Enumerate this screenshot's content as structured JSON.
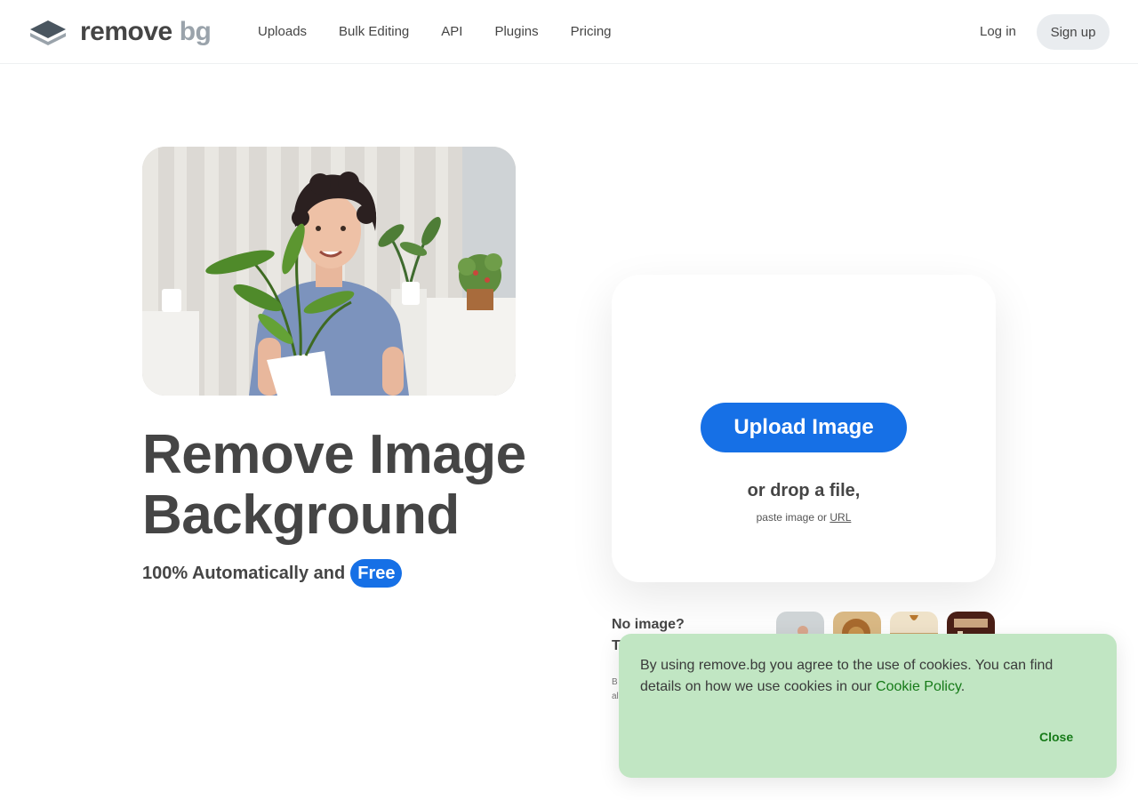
{
  "header": {
    "logo_word": "remove",
    "logo_bg": "bg",
    "nav": [
      {
        "label": "Uploads"
      },
      {
        "label": "Bulk Editing"
      },
      {
        "label": "API"
      },
      {
        "label": "Plugins"
      },
      {
        "label": "Pricing"
      }
    ],
    "login_label": "Log in",
    "signup_label": "Sign up"
  },
  "hero": {
    "title_line1": "Remove Image",
    "title_line2": "Background",
    "subtitle": "100% Automatically and",
    "badge": "Free"
  },
  "upload": {
    "button_label": "Upload Image",
    "drop_text": "or drop a file,",
    "paste_text": "paste image or",
    "url_link": "URL"
  },
  "samples": {
    "no_image": "No image?",
    "try_prefix": "T",
    "fine_print_1": "B",
    "fine_print_2": "al",
    "thumbnails": [
      {
        "icon": "woman-thumb-icon"
      },
      {
        "icon": "lion-thumb-icon"
      },
      {
        "icon": "desert-thumb-icon"
      },
      {
        "icon": "interior-thumb-icon"
      }
    ]
  },
  "cookie": {
    "text": "By using remove.bg you agree to the use of cookies. You can find details on how we use cookies in our",
    "link_label": "Cookie Policy",
    "period": ".",
    "close_label": "Close"
  },
  "colors": {
    "primary": "#1670e6",
    "text": "#454545",
    "cookie_bg": "#c1e6c3",
    "cookie_link": "#167a18",
    "signup_bg": "#e9ecef"
  }
}
